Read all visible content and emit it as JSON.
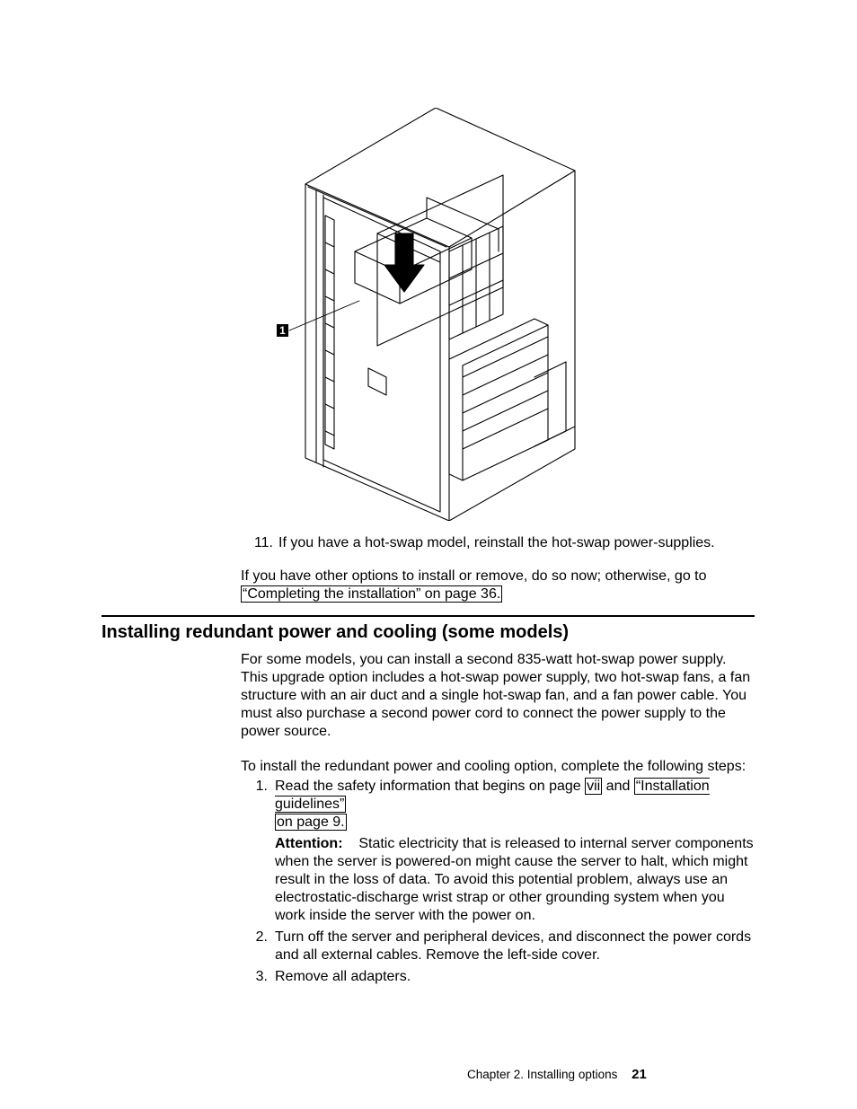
{
  "figure": {
    "callout_label": "1"
  },
  "step11": {
    "number": "11.",
    "text": "If you have a hot-swap model, reinstall the hot-swap power-supplies."
  },
  "after_para": {
    "line1": "If you have other options to install or remove, do so now; otherwise, go to",
    "link": "“Completing the installation” on page 36."
  },
  "heading": "Installing redundant power and cooling (some models)",
  "intro": "For some models, you can install a second 835-watt hot-swap power supply. This upgrade option includes a hot-swap power supply, two hot-swap fans, a fan structure with an air duct and a single hot-swap fan, and a fan power cable. You must also purchase a second power cord to connect the power supply to the power source.",
  "lead": "To install the redundant power and cooling option, complete the following steps:",
  "steps": [
    {
      "number": "1.",
      "prefix": "Read the safety information that begins on page ",
      "link1": "vii",
      "mid": " and ",
      "link2": "“Installation guidelines”",
      "link2b": "on page 9.",
      "attention_label": "Attention:",
      "attention_body": " Static electricity that is released to internal server components when the server is powered-on might cause the server to halt, which might result in the loss of data. To avoid this potential problem, always use an electrostatic-discharge wrist strap or other grounding system when you work inside the server with the power on."
    },
    {
      "number": "2.",
      "text": "Turn off the server and peripheral devices, and disconnect the power cords and all external cables. Remove the left-side cover."
    },
    {
      "number": "3.",
      "text": "Remove all adapters."
    }
  ],
  "footer": {
    "chapter": "Chapter 2. Installing options",
    "page": "21"
  }
}
